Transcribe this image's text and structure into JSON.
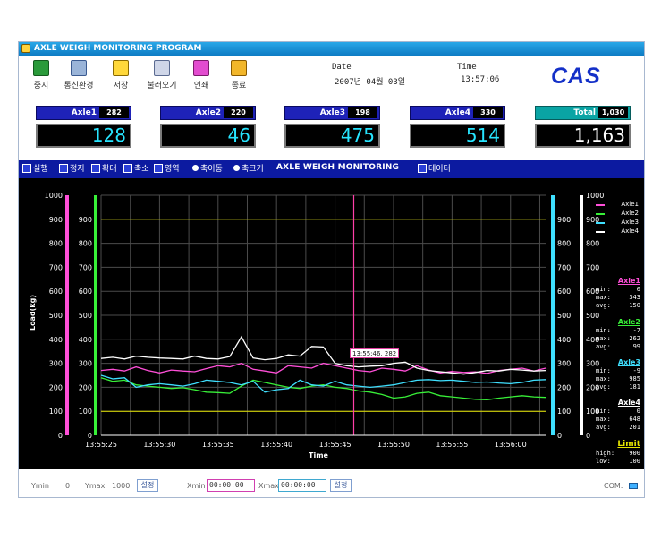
{
  "window": {
    "title": "AXLE WEIGH MONITORING PROGRAM"
  },
  "toolbar": {
    "stop": "중지",
    "comm": "통신환경",
    "save": "저장",
    "load": "불러오기",
    "print": "인쇄",
    "exit": "종료"
  },
  "datetime": {
    "date_label": "Date",
    "date_value": "2007년 04월 03일",
    "time_label": "Time",
    "time_value": "13:57:06"
  },
  "brand": "CAS",
  "axles": [
    {
      "label": "Axle1",
      "small": "282",
      "big": "128"
    },
    {
      "label": "Axle2",
      "small": "220",
      "big": "46"
    },
    {
      "label": "Axle3",
      "small": "198",
      "big": "475"
    },
    {
      "label": "Axle4",
      "small": "330",
      "big": "514"
    }
  ],
  "total": {
    "label": "Total",
    "small": "1,030",
    "big": "1,163"
  },
  "chartbar": {
    "run": "실행",
    "stop": "정지",
    "zoom_in": "확대",
    "zoom_out": "축소",
    "area": "영역",
    "axis_move": "축이동",
    "axis_size": "축크기",
    "title": "AXLE WEIGH MONITORING",
    "data": "데이터"
  },
  "tooltip": "13:55:46, 282",
  "stats": [
    {
      "name": "Axle1",
      "color": "#ff4fd8",
      "min": "0",
      "max": "343",
      "avg": "150"
    },
    {
      "name": "Axle2",
      "color": "#38f038",
      "min": "-7",
      "max": "262",
      "avg": "99"
    },
    {
      "name": "Axle3",
      "color": "#3fe0ff",
      "min": "-9",
      "max": "985",
      "avg": "181"
    },
    {
      "name": "Axle4",
      "color": "#ffffff",
      "min": "0",
      "max": "648",
      "avg": "201"
    }
  ],
  "limit": {
    "title": "Limit",
    "high_label": "high:",
    "high": "900",
    "low_label": "low:",
    "low": "100"
  },
  "stat_labels": {
    "min": "min:",
    "max": "max:",
    "avg": "avg:"
  },
  "bottom": {
    "ymin_label": "Ymin",
    "ymin": "0",
    "ymax_label": "Ymax",
    "ymax": "1000",
    "set": "설정",
    "xmin_label": "Xmin",
    "xmin": "00:00:00",
    "xmax_label": "Xmax",
    "xmax": "00:00:00",
    "com": "COM:"
  },
  "colors": {
    "axle1": "#ff4fd8",
    "axle2": "#38f038",
    "axle3": "#3fe0ff",
    "axle4": "#ffffff",
    "limit": "#e6e600",
    "grid": "#4b4b4b",
    "cursor": "#ff3fa8"
  },
  "chart_data": {
    "type": "line",
    "ylabel": "Load(kg)",
    "xlabel": "Time",
    "ylim": [
      0,
      1000
    ],
    "y_ticks": [
      0,
      100,
      200,
      300,
      400,
      500,
      600,
      700,
      800,
      900,
      1000
    ],
    "x_ticks": [
      "13:55:25",
      "13:55:30",
      "13:55:35",
      "13:55:40",
      "13:55:45",
      "13:55:50",
      "13:55:55",
      "13:56:00"
    ],
    "x_range_s": [
      0,
      38
    ],
    "cursor_s": 21.6,
    "limits": {
      "high": 900,
      "low": 100
    },
    "x_s": [
      0,
      1,
      2,
      3,
      4,
      5,
      6,
      7,
      8,
      9,
      10,
      11,
      12,
      13,
      14,
      15,
      16,
      17,
      18,
      19,
      20,
      21,
      22,
      23,
      24,
      25,
      26,
      27,
      28,
      29,
      30,
      31,
      32,
      33,
      34,
      35,
      36,
      37,
      38
    ],
    "series": [
      {
        "name": "Axle1",
        "values": [
          270,
          275,
          268,
          285,
          270,
          260,
          272,
          268,
          265,
          278,
          290,
          285,
          300,
          275,
          268,
          260,
          290,
          285,
          280,
          300,
          290,
          280,
          270,
          265,
          280,
          275,
          268,
          290,
          272,
          260,
          266,
          262,
          264,
          258,
          270,
          275,
          280,
          268,
          280
        ]
      },
      {
        "name": "Axle2",
        "values": [
          240,
          225,
          230,
          210,
          205,
          200,
          195,
          198,
          190,
          180,
          178,
          175,
          205,
          230,
          220,
          210,
          200,
          195,
          205,
          210,
          200,
          195,
          185,
          180,
          170,
          155,
          160,
          175,
          180,
          165,
          160,
          155,
          150,
          148,
          155,
          160,
          165,
          160,
          158
        ]
      },
      {
        "name": "Axle3",
        "values": [
          250,
          235,
          240,
          200,
          210,
          215,
          210,
          205,
          215,
          230,
          225,
          220,
          210,
          225,
          180,
          190,
          195,
          230,
          210,
          205,
          225,
          210,
          205,
          200,
          205,
          210,
          220,
          230,
          232,
          228,
          230,
          225,
          220,
          222,
          218,
          215,
          220,
          230,
          232
        ]
      },
      {
        "name": "Axle4",
        "values": [
          320,
          325,
          318,
          330,
          325,
          322,
          320,
          318,
          330,
          320,
          318,
          328,
          410,
          322,
          315,
          320,
          335,
          330,
          370,
          368,
          300,
          290,
          285,
          288,
          290,
          300,
          305,
          280,
          270,
          265,
          260,
          255,
          262,
          270,
          268,
          275,
          272,
          268,
          270
        ]
      }
    ]
  }
}
